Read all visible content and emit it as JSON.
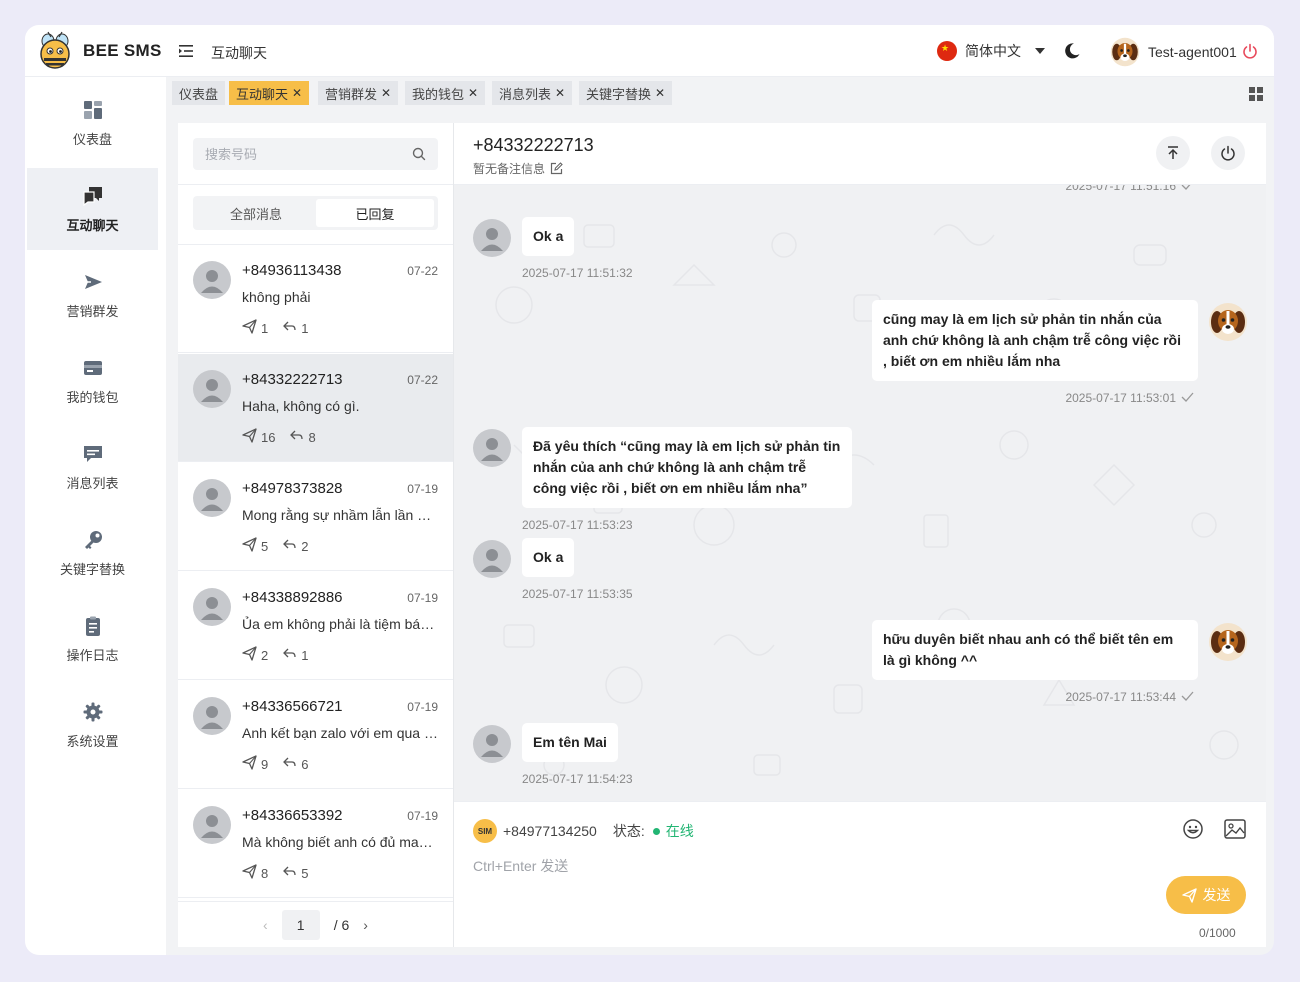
{
  "header": {
    "brand": "BEE SMS",
    "title": "互动聊天",
    "language": "简体中文",
    "username": "Test-agent001"
  },
  "sidebar": {
    "items": [
      {
        "label": "仪表盘",
        "icon": "dashboard-icon"
      },
      {
        "label": "互动聊天",
        "icon": "chat-icon",
        "active": true
      },
      {
        "label": "营销群发",
        "icon": "send-icon"
      },
      {
        "label": "我的钱包",
        "icon": "wallet-icon"
      },
      {
        "label": "消息列表",
        "icon": "message-icon"
      },
      {
        "label": "关键字替换",
        "icon": "key-icon"
      },
      {
        "label": "操作日志",
        "icon": "clipboard-icon"
      },
      {
        "label": "系统设置",
        "icon": "gear-icon"
      }
    ]
  },
  "tabs": [
    {
      "label": "仪表盘",
      "closable": false
    },
    {
      "label": "互动聊天",
      "closable": true,
      "active": true
    },
    {
      "label": "营销群发",
      "closable": true
    },
    {
      "label": "我的钱包",
      "closable": true
    },
    {
      "label": "消息列表",
      "closable": true
    },
    {
      "label": "关键字替换",
      "closable": true
    }
  ],
  "conversations": {
    "search_placeholder": "搜索号码",
    "filters": [
      "全部消息",
      "已回复"
    ],
    "active_filter": 1,
    "items": [
      {
        "phone": "+84936113438",
        "date": "07-22",
        "message": "không phải",
        "sent": "1",
        "replied": "1"
      },
      {
        "phone": "+84332222713",
        "date": "07-22",
        "message": "Haha, không có gì.",
        "sent": "16",
        "replied": "8",
        "active": true
      },
      {
        "phone": "+84978373828",
        "date": "07-19",
        "message": "Mong rằng sự nhầm lẫn lần này không làm phiền anh",
        "sent": "5",
        "replied": "2"
      },
      {
        "phone": "+84338892886",
        "date": "07-19",
        "message": "Ủa em không phải là tiệm bánh à",
        "sent": "2",
        "replied": "1"
      },
      {
        "phone": "+84336566721",
        "date": "07-19",
        "message": "Anh kết bạn zalo với em qua số này nhé",
        "sent": "9",
        "replied": "6"
      },
      {
        "phone": "+84336653392",
        "date": "07-19",
        "message": "Mà không biết anh có đủ may mắn không",
        "sent": "8",
        "replied": "5"
      }
    ],
    "pagination": {
      "current": "1",
      "total": "/ 6"
    }
  },
  "chat": {
    "phone": "+84332222713",
    "remark": "暂无备注信息",
    "top_partial_time": "2025-07-17 11:51:16",
    "messages": [
      {
        "side": "in",
        "text": "Ok a",
        "time": "2025-07-17 11:51:32"
      },
      {
        "side": "out",
        "text": "cũng may là em lịch sử phản tin nhắn của anh chứ không là anh chậm trễ công việc rồi , biết ơn em nhiều lắm nha",
        "time": "2025-07-17 11:53:01"
      },
      {
        "side": "in",
        "text": "Đã yêu thích “cũng may là em lịch sử phản tin nhắn của anh chứ không là anh chậm trễ công việc rồi , biết ơn em nhiều lắm nha”",
        "time": "2025-07-17 11:53:23"
      },
      {
        "side": "in",
        "text": "Ok a",
        "time": "2025-07-17 11:53:35"
      },
      {
        "side": "out",
        "text": "hữu duyên biết nhau anh có thể biết tên em là gì không ^^",
        "time": "2025-07-17 11:53:44"
      },
      {
        "side": "in",
        "text": "Em tên Mai",
        "time": "2025-07-17 11:54:23"
      }
    ]
  },
  "composer": {
    "sim_label": "SIM",
    "sim_number": "+84977134250",
    "status_label": "状态:",
    "status_value": "在线",
    "placeholder": "Ctrl+Enter 发送",
    "send_label": "发送",
    "counter": "0/1000"
  },
  "colors": {
    "accent": "#f7be48",
    "online": "#22b573",
    "logout": "#e8495b"
  }
}
